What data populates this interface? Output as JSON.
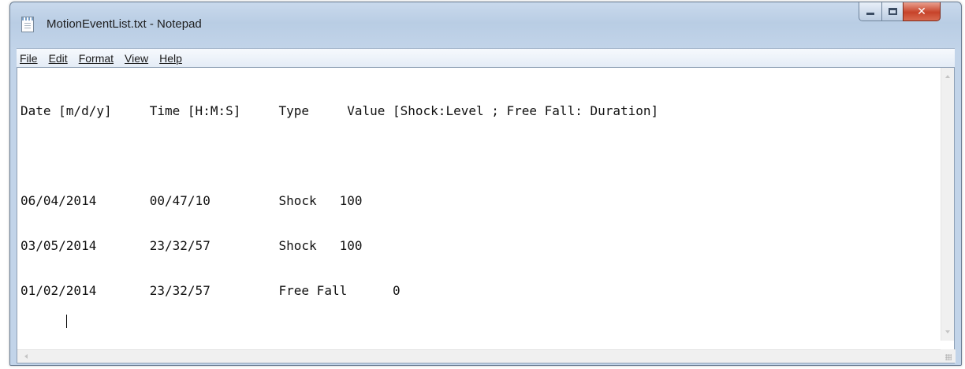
{
  "window": {
    "title": "MotionEventList.txt - Notepad",
    "icon": "notepad-icon",
    "controls": {
      "minimize": "minimize-icon",
      "maximize": "maximize-icon",
      "close": "close-icon"
    }
  },
  "menu": {
    "items": [
      "File",
      "Edit",
      "Format",
      "View",
      "Help"
    ]
  },
  "document": {
    "header": "Date [m/d/y]     Time [H:M:S]     Type     Value [Shock:Level ; Free Fall: Duration]",
    "rows": [
      "06/04/2014       00/47/10         Shock   100",
      "03/05/2014       23/32/57         Shock   100",
      "01/02/2014       23/32/57         Free Fall      0"
    ]
  }
}
